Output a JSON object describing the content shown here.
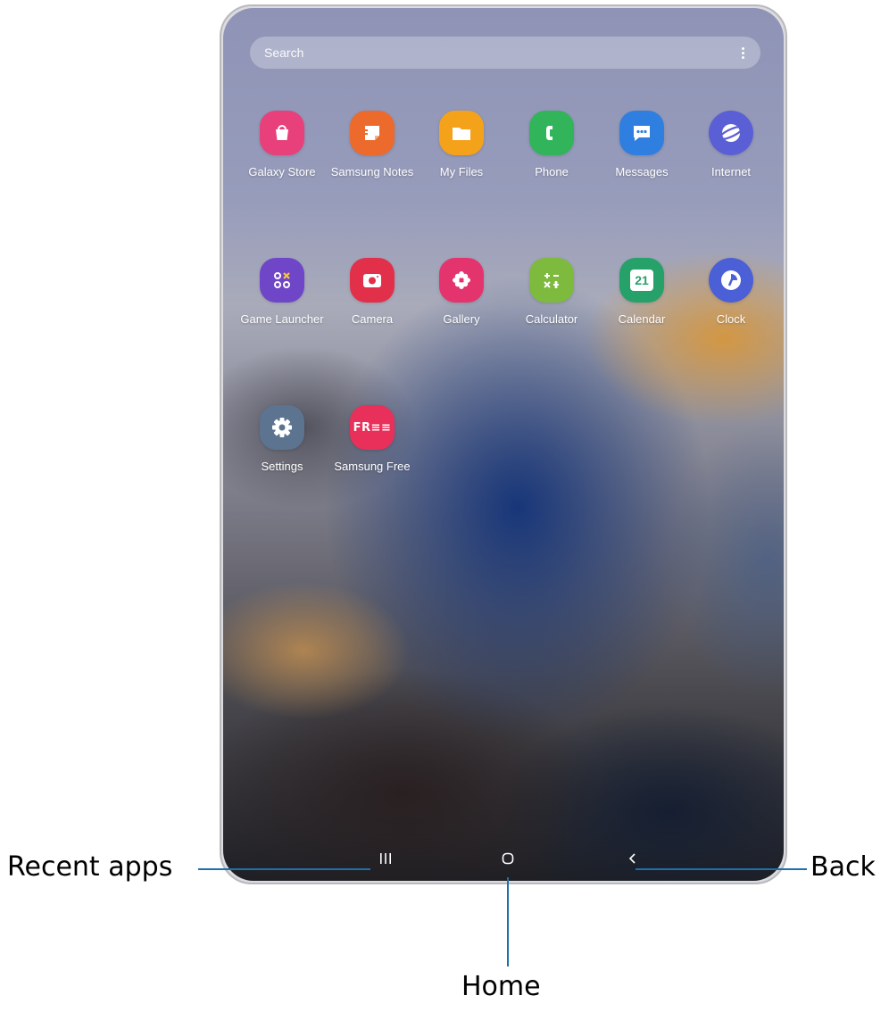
{
  "search": {
    "placeholder": "Search"
  },
  "apps": [
    {
      "label": "Galaxy Store",
      "icon": "galaxy-store-icon",
      "color": "#e8407a"
    },
    {
      "label": "Samsung Notes",
      "icon": "samsung-notes-icon",
      "color": "#ec6a2c"
    },
    {
      "label": "My Files",
      "icon": "folder-icon",
      "color": "#f5a21b"
    },
    {
      "label": "Phone",
      "icon": "phone-icon",
      "color": "#31b45a"
    },
    {
      "label": "Messages",
      "icon": "messages-icon",
      "color": "#2f7fe0"
    },
    {
      "label": "Internet",
      "icon": "internet-icon",
      "color": "#5b5fd6"
    },
    {
      "label": "Game Launcher",
      "icon": "game-launcher-icon",
      "color": "#6f46c8"
    },
    {
      "label": "Camera",
      "icon": "camera-icon",
      "color": "#e3304a"
    },
    {
      "label": "Gallery",
      "icon": "gallery-icon",
      "color": "#e4346e"
    },
    {
      "label": "Calculator",
      "icon": "calculator-icon",
      "color": "#7dba3e"
    },
    {
      "label": "Calendar",
      "icon": "calendar-icon",
      "color": "#26a169"
    },
    {
      "label": "Clock",
      "icon": "clock-icon",
      "color": "#4b5fd6"
    },
    {
      "label": "Settings",
      "icon": "gear-icon",
      "color": "#5c7490"
    },
    {
      "label": "Samsung Free",
      "icon": "samsung-free-icon",
      "color": "#e8305a"
    }
  ],
  "calendar_day": "21",
  "free_text": "FR≡≡",
  "callouts": {
    "recent": "Recent apps",
    "home": "Home",
    "back": "Back"
  },
  "colors": {
    "callout_line": "#1f6fa8"
  }
}
